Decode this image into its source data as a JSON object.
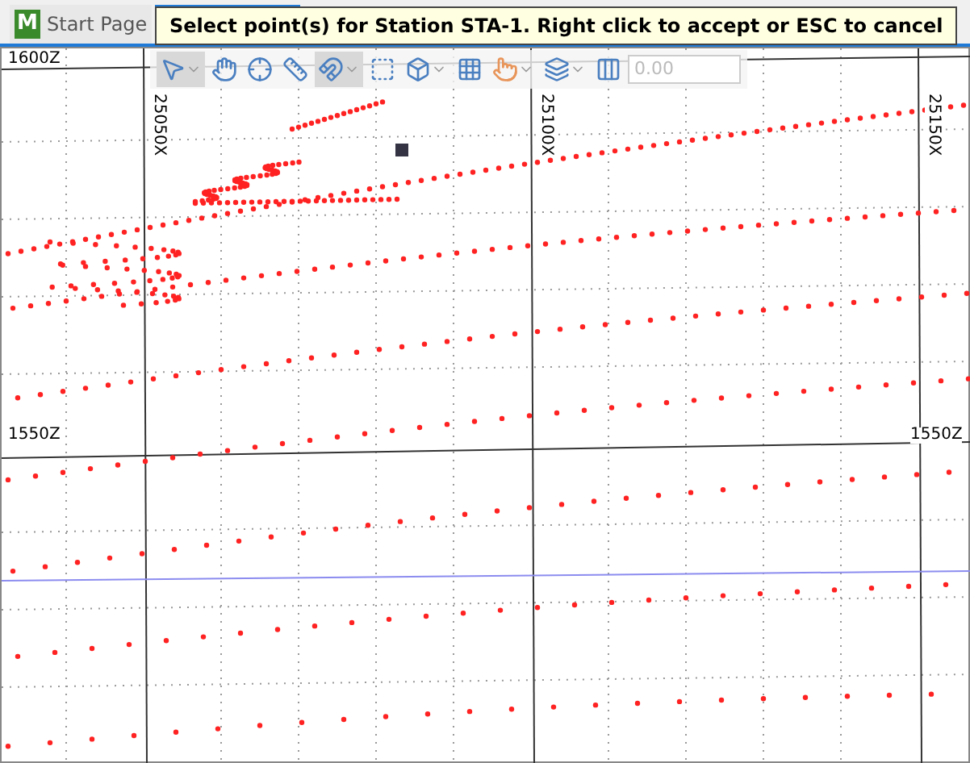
{
  "tabs": [
    {
      "logo": "M",
      "label": "Start Page",
      "selected": false
    },
    {
      "selected": true
    }
  ],
  "tooltip": "Select point(s) for Station STA-1. Right click to accept or ESC to cancel",
  "toolbar": {
    "buttons": [
      {
        "selected": true,
        "dropdown": true
      },
      {
        "selected": false,
        "dropdown": false
      },
      {
        "selected": false,
        "dropdown": false
      },
      {
        "selected": false,
        "dropdown": false
      },
      {
        "selected": true,
        "dropdown": true
      },
      {
        "selected": false,
        "dropdown": false
      },
      {
        "selected": false,
        "dropdown": true
      },
      {
        "selected": false,
        "dropdown": false
      },
      {
        "selected": false,
        "dropdown": true
      },
      {
        "selected": false,
        "dropdown": true
      },
      {
        "selected": false,
        "dropdown": false
      }
    ],
    "value_field": {
      "value": "0.00",
      "disabled": true
    }
  },
  "canvas": {
    "z_labels": [
      "1600Z",
      "1550Z",
      "1550Z"
    ],
    "x_labels": [
      "25050X",
      "25100X",
      "25150X"
    ]
  }
}
